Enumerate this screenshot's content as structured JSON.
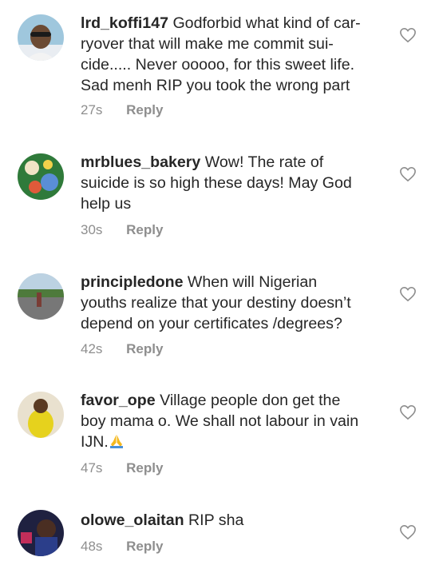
{
  "comments": [
    {
      "username": "lrd_koffi147",
      "text": "Godforbid what kind of car-ryover that will make me commit sui-cide..... Never ooooo, for this sweet life. Sad menh RIP you took the wrong part",
      "lines": [
        "lrd_koffi147 Godforbid what kind of car-",
        "ryover that will make me commit sui-",
        "cide..... Never ooooo, for this sweet life.",
        "Sad menh RIP you took the wrong part"
      ],
      "time": "27s",
      "reply": "Reply"
    },
    {
      "username": "mrblues_bakery",
      "text": "Wow! The rate of suicide is so high these days! May God help us",
      "lines": [
        "mrblues_bakery Wow! The rate of",
        "suicide is so high these days! May God",
        "help us"
      ],
      "time": "30s",
      "reply": "Reply"
    },
    {
      "username": "principledone",
      "text": "When will Nigerian youths realize that your destiny doesn't depend on your certificates /degrees?",
      "lines": [
        "principledone When will Nigerian",
        "youths realize that your destiny doesn't",
        "depend on your certificates /degrees?"
      ],
      "time": "42s",
      "reply": "Reply"
    },
    {
      "username": "favor_ope",
      "text": "Village people don get the boy mama o. We shall not labour in vain IJN.",
      "emoji": "folded-hands",
      "time": "47s",
      "reply": "Reply"
    },
    {
      "username": "olowe_olaitan",
      "text": "RIP sha",
      "time": "48s",
      "reply": "Reply"
    }
  ],
  "icons": {
    "like": "heart-outline-icon",
    "emoji": "folded-hands-icon"
  },
  "colors": {
    "text": "#262626",
    "meta": "#8e8e8e",
    "emoji": "#f5b81e"
  }
}
